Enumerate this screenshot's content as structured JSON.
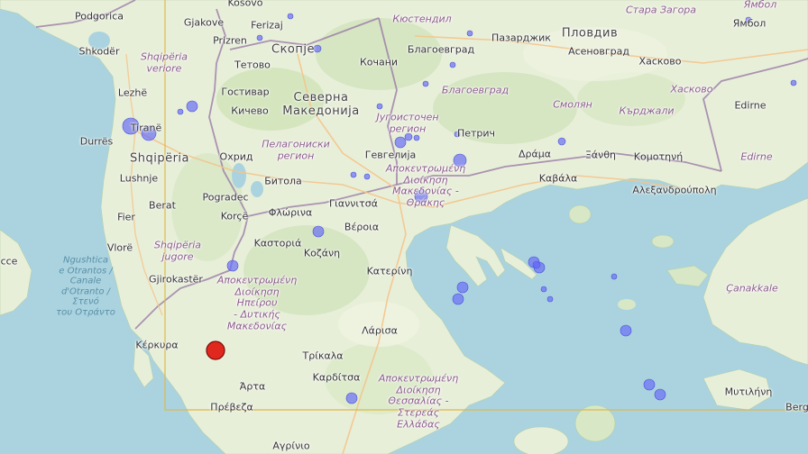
{
  "map": {
    "labels": [
      {
        "id": "podgorica",
        "text": "Podgorica",
        "type": "city"
      },
      {
        "id": "shkoder",
        "text": "Shkodër",
        "type": "city"
      },
      {
        "id": "shqiperia-veriore",
        "text": "Shqipëria\nveriore",
        "type": "region"
      },
      {
        "id": "lezhe",
        "text": "Lezhë",
        "type": "city"
      },
      {
        "id": "tirane",
        "text": "Tiranë",
        "type": "city"
      },
      {
        "id": "durres",
        "text": "Durrës",
        "type": "city"
      },
      {
        "id": "shqiperia",
        "text": "Shqipëria",
        "type": "big"
      },
      {
        "id": "lushnje",
        "text": "Lushnje",
        "type": "city"
      },
      {
        "id": "fier",
        "text": "Fier",
        "type": "city"
      },
      {
        "id": "berat",
        "text": "Berat",
        "type": "city"
      },
      {
        "id": "vlore",
        "text": "Vlorë",
        "type": "city"
      },
      {
        "id": "pogradec",
        "text": "Pogradec",
        "type": "city"
      },
      {
        "id": "korce",
        "text": "Korçë",
        "type": "city"
      },
      {
        "id": "shqiperia-jugore",
        "text": "Shqipëria\njugore",
        "type": "region"
      },
      {
        "id": "gjirokaster",
        "text": "Gjirokastër",
        "type": "city"
      },
      {
        "id": "kerkyra",
        "text": "Κέρκυρα",
        "type": "city"
      },
      {
        "id": "gjakove",
        "text": "Gjakove",
        "type": "city"
      },
      {
        "id": "ferizaj",
        "text": "Ferizaj",
        "type": "city"
      },
      {
        "id": "prizren",
        "text": "Prizren",
        "type": "city"
      },
      {
        "id": "kosovo",
        "text": "Kosovo",
        "type": "city"
      },
      {
        "id": "skopje",
        "text": "Скопје",
        "type": "big"
      },
      {
        "id": "tetovo",
        "text": "Тетово",
        "type": "city"
      },
      {
        "id": "gostivar",
        "text": "Гостивар",
        "type": "city"
      },
      {
        "id": "kicevo",
        "text": "Кичево",
        "type": "city"
      },
      {
        "id": "severna-makedonija",
        "text": "Северна\nМакедонија",
        "type": "big"
      },
      {
        "id": "ohrid",
        "text": "Охрид",
        "type": "city"
      },
      {
        "id": "bitola",
        "text": "Битола",
        "type": "city"
      },
      {
        "id": "pelagoniski",
        "text": "Пелагониски\nрегион",
        "type": "region"
      },
      {
        "id": "jugoistochen",
        "text": "Југоисточен\nрегион",
        "type": "region"
      },
      {
        "id": "kochani",
        "text": "Кочани",
        "type": "city"
      },
      {
        "id": "gevgelija",
        "text": "Гевгелија",
        "type": "city"
      },
      {
        "id": "kyustendil",
        "text": "Кюстендил",
        "type": "region"
      },
      {
        "id": "blagoevgrad-city",
        "text": "Благоевград",
        "type": "city"
      },
      {
        "id": "blagoevgrad-region",
        "text": "Благоевград",
        "type": "region"
      },
      {
        "id": "petrich",
        "text": "Петрич",
        "type": "city"
      },
      {
        "id": "pazardzhik",
        "text": "Пазарджик",
        "type": "city"
      },
      {
        "id": "plovdiv",
        "text": "Пловдив",
        "type": "big"
      },
      {
        "id": "asenovgrad",
        "text": "Асеновград",
        "type": "city"
      },
      {
        "id": "haskovo-city",
        "text": "Хасково",
        "type": "city"
      },
      {
        "id": "haskovo-region",
        "text": "Хасково",
        "type": "region"
      },
      {
        "id": "stara-zagora",
        "text": "Стара Загора",
        "type": "region"
      },
      {
        "id": "yambol-city",
        "text": "Ямбол",
        "type": "city"
      },
      {
        "id": "yambol-region",
        "text": "Ямбол",
        "type": "region"
      },
      {
        "id": "smolyan",
        "text": "Смолян",
        "type": "region"
      },
      {
        "id": "kardzhali",
        "text": "Кърджали",
        "type": "region"
      },
      {
        "id": "edirne-city",
        "text": "Edirne",
        "type": "city"
      },
      {
        "id": "edirne-region",
        "text": "Edirne",
        "type": "region"
      },
      {
        "id": "drama",
        "text": "Δράμα",
        "type": "city"
      },
      {
        "id": "xanthi",
        "text": "Ξάνθη",
        "type": "city"
      },
      {
        "id": "komotini",
        "text": "Κομοτηνή",
        "type": "city"
      },
      {
        "id": "kavala",
        "text": "Καβάλα",
        "type": "city"
      },
      {
        "id": "alexandroupoli",
        "text": "Αλεξανδρούπολη",
        "type": "city"
      },
      {
        "id": "amt",
        "text": "Αποκεντρωμένη\nΔιοίκηση\nΜακεδονίας -\nΘράκης",
        "type": "region"
      },
      {
        "id": "florina",
        "text": "Φλώρινα",
        "type": "city"
      },
      {
        "id": "giannitsa",
        "text": "Γιαννιτσά",
        "type": "city"
      },
      {
        "id": "veroia",
        "text": "Βέροια",
        "type": "city"
      },
      {
        "id": "kastoria",
        "text": "Καστοριά",
        "type": "city"
      },
      {
        "id": "kozani",
        "text": "Κοζάνη",
        "type": "city"
      },
      {
        "id": "katerini",
        "text": "Κατερίνη",
        "type": "city"
      },
      {
        "id": "aedm",
        "text": "Αποκεντρωμένη\nΔιοίκηση\nΗπείρου\n- Δυτικής\nΜακεδονίας",
        "type": "region"
      },
      {
        "id": "larisa",
        "text": "Λάρισα",
        "type": "city"
      },
      {
        "id": "trikala",
        "text": "Τρίκαλα",
        "type": "city"
      },
      {
        "id": "karditsa",
        "text": "Καρδίτσα",
        "type": "city"
      },
      {
        "id": "arta",
        "text": "Άρτα",
        "type": "city"
      },
      {
        "id": "preveza",
        "text": "Πρέβεζα",
        "type": "city"
      },
      {
        "id": "agrinio",
        "text": "Αγρίνιο",
        "type": "city"
      },
      {
        "id": "athes",
        "text": "Αποκεντρωμένη\nΔιοίκηση\nΘεσσαλίας -\nΣτερεάς\nΕλλάδας",
        "type": "region"
      },
      {
        "id": "canakkale",
        "text": "Çanakkale",
        "type": "region"
      },
      {
        "id": "mytilini",
        "text": "Μυτιλήνη",
        "type": "city"
      },
      {
        "id": "berg",
        "text": "Berg",
        "type": "city"
      },
      {
        "id": "otranto",
        "text": "Ngushtica\ne Otrantos /\nCanale\nd'Otranto /\nΣτενό\nτου Οτράντο",
        "type": "sea"
      },
      {
        "id": "cce",
        "text": "cce",
        "type": "city"
      }
    ]
  }
}
